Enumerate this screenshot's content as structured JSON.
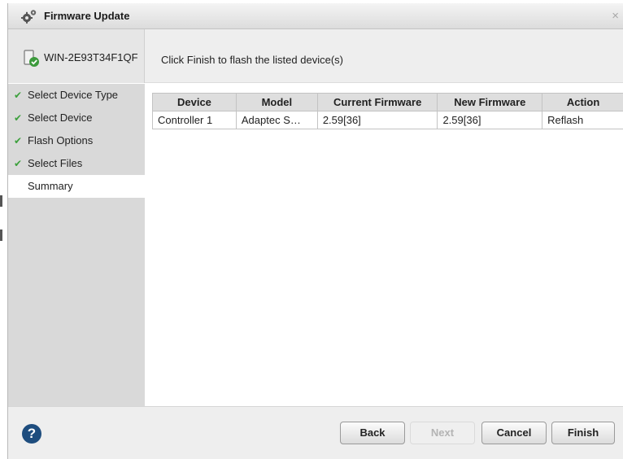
{
  "window": {
    "title": "Firmware Update",
    "close_glyph": "×",
    "icon": "gears-icon"
  },
  "header": {
    "host_name": "WIN-2E93T34F1QF",
    "host_icon": "server-check-icon",
    "instruction": "Click Finish to flash the listed device(s)"
  },
  "steps": [
    {
      "label": "Select Device Type",
      "completed": true
    },
    {
      "label": "Select Device",
      "completed": true
    },
    {
      "label": "Flash Options",
      "completed": true
    },
    {
      "label": "Select Files",
      "completed": true
    },
    {
      "label": "Summary",
      "completed": false,
      "active": true
    }
  ],
  "check_glyph": "✔",
  "table": {
    "columns": [
      "Device",
      "Model",
      "Current Firmware",
      "New Firmware",
      "Action"
    ],
    "rows": [
      [
        "Controller 1",
        "Adaptec S…",
        "2.59[36]",
        "2.59[36]",
        "Reflash"
      ]
    ]
  },
  "footer": {
    "help_glyph": "?",
    "back_label": "Back",
    "next_label": "Next",
    "cancel_label": "Cancel",
    "finish_label": "Finish"
  },
  "colors": {
    "check_green": "#3ca03c",
    "help_blue": "#1e4d7e",
    "sidebar_bg": "#d9d9d9"
  }
}
